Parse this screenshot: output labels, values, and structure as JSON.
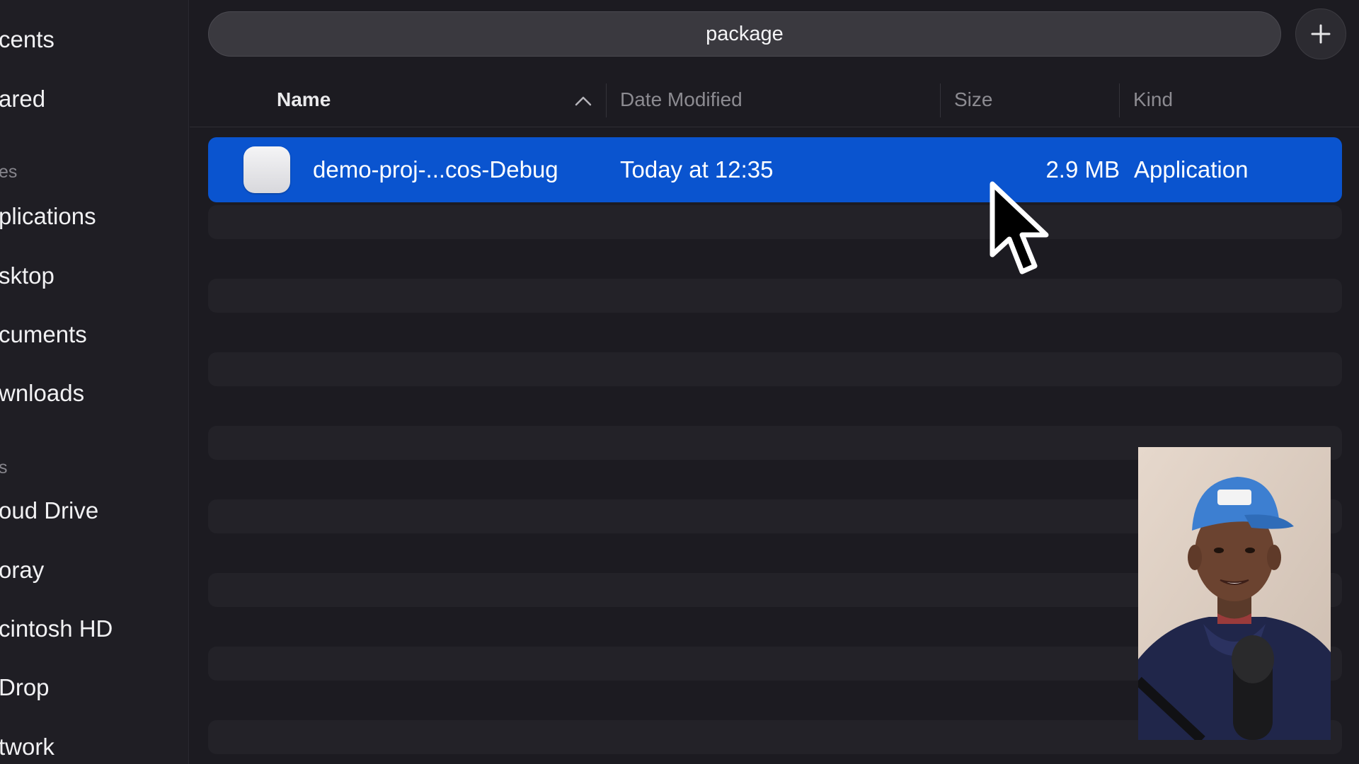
{
  "sidebar": {
    "items": [
      {
        "label": "cents"
      },
      {
        "label": "ared"
      }
    ],
    "sections": [
      {
        "heading": "es",
        "items": [
          {
            "label": "plications"
          },
          {
            "label": "sktop"
          },
          {
            "label": "cuments"
          },
          {
            "label": "wnloads"
          }
        ]
      },
      {
        "heading": "s",
        "items": [
          {
            "label": "oud Drive"
          },
          {
            "label": "oray"
          },
          {
            "label": "cintosh HD"
          },
          {
            "label": "Drop"
          },
          {
            "label": "twork"
          }
        ]
      }
    ]
  },
  "toolbar": {
    "path_title": "package",
    "add_button_icon": "plus-icon"
  },
  "columns": {
    "name": "Name",
    "date_modified": "Date Modified",
    "size": "Size",
    "kind": "Kind",
    "sort_icon": "chevron-up-icon"
  },
  "files": [
    {
      "name": "demo-proj-...cos-Debug",
      "date_modified": "Today at 12:35",
      "size": "2.9 MB",
      "kind": "Application",
      "icon": "application-icon",
      "selected": true
    }
  ],
  "colors": {
    "selection": "#0a54cf",
    "background": "#1c1b21",
    "sidebar_background": "#1f1e24"
  }
}
